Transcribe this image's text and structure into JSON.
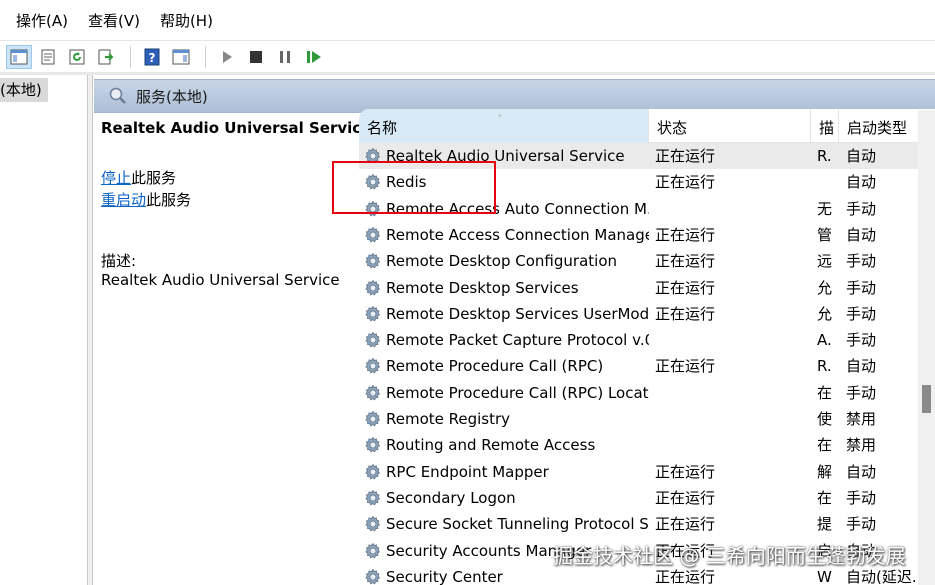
{
  "menu": [
    {
      "label": "操作(A)"
    },
    {
      "label": "查看(V)"
    },
    {
      "label": "帮助(H)"
    }
  ],
  "tree": {
    "selected_label": "(本地)"
  },
  "pane": {
    "title": "服务(本地)"
  },
  "detail": {
    "service_name": "Realtek Audio Universal Service",
    "stop_link": "停止",
    "stop_suffix": "此服务",
    "restart_link": "重启动",
    "restart_suffix": "此服务",
    "desc_label": "描述:",
    "desc_text": "Realtek Audio Universal Service"
  },
  "columns": {
    "name": "名称",
    "status": "状态",
    "desc": "描",
    "start": "启动类型"
  },
  "services": [
    {
      "name": "Realtek Audio Universal Service",
      "status": "正在运行",
      "desc": "R.",
      "start": "自动"
    },
    {
      "name": "Redis",
      "status": "正在运行",
      "desc": "",
      "start": "自动"
    },
    {
      "name": "Remote Access Auto Connection M...",
      "status": "",
      "desc": "无",
      "start": "手动"
    },
    {
      "name": "Remote Access Connection Manager",
      "status": "正在运行",
      "desc": "管",
      "start": "自动"
    },
    {
      "name": "Remote Desktop Configuration",
      "status": "正在运行",
      "desc": "远",
      "start": "手动"
    },
    {
      "name": "Remote Desktop Services",
      "status": "正在运行",
      "desc": "允",
      "start": "手动"
    },
    {
      "name": "Remote Desktop Services UserMod...",
      "status": "正在运行",
      "desc": "允",
      "start": "手动"
    },
    {
      "name": "Remote Packet Capture Protocol v.0...",
      "status": "",
      "desc": "A.",
      "start": "手动"
    },
    {
      "name": "Remote Procedure Call (RPC)",
      "status": "正在运行",
      "desc": "R.",
      "start": "自动"
    },
    {
      "name": "Remote Procedure Call (RPC) Locator",
      "status": "",
      "desc": "在",
      "start": "手动"
    },
    {
      "name": "Remote Registry",
      "status": "",
      "desc": "使",
      "start": "禁用"
    },
    {
      "name": "Routing and Remote Access",
      "status": "",
      "desc": "在",
      "start": "禁用"
    },
    {
      "name": "RPC Endpoint Mapper",
      "status": "正在运行",
      "desc": "解",
      "start": "自动"
    },
    {
      "name": "Secondary Logon",
      "status": "正在运行",
      "desc": "在",
      "start": "手动"
    },
    {
      "name": "Secure Socket Tunneling Protocol S...",
      "status": "正在运行",
      "desc": "提",
      "start": "手动"
    },
    {
      "name": "Security Accounts Manager",
      "status": "正在运行",
      "desc": "启",
      "start": "自动"
    },
    {
      "name": "Security Center",
      "status": "正在运行",
      "desc": "W",
      "start": "自动(延迟..."
    }
  ],
  "watermark": "掘金技术社区 @ 三希向阳而生蓬勃发展",
  "colors": {
    "accent": "#0b63c5",
    "highlight": "#e60012",
    "header": "#b9c9dd"
  }
}
